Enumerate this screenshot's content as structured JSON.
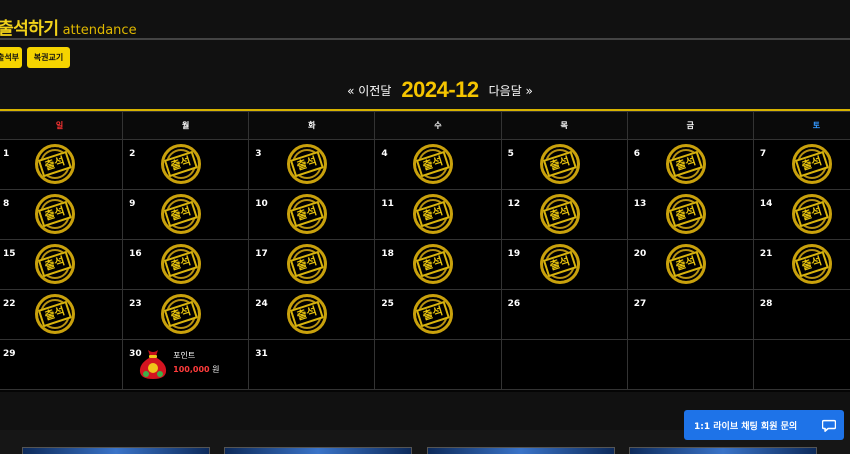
{
  "header": {
    "title": "출석하기",
    "subtitle": "attendance"
  },
  "tabs": [
    {
      "label": "출석부"
    },
    {
      "label": "복권교기"
    }
  ],
  "month_nav": {
    "prev_label": "« 이전달",
    "current_month": "2024-12",
    "next_label": "다음달 »"
  },
  "calendar": {
    "weekday_headers": [
      "일",
      "월",
      "화",
      "수",
      "목",
      "금",
      "토"
    ],
    "stamp_label": "출석",
    "weeks": [
      [
        {
          "day": "1",
          "stamp": true
        },
        {
          "day": "2",
          "stamp": true
        },
        {
          "day": "3",
          "stamp": true
        },
        {
          "day": "4",
          "stamp": true
        },
        {
          "day": "5",
          "stamp": true
        },
        {
          "day": "6",
          "stamp": true
        },
        {
          "day": "7",
          "stamp": true
        }
      ],
      [
        {
          "day": "8",
          "stamp": true
        },
        {
          "day": "9",
          "stamp": true
        },
        {
          "day": "10",
          "stamp": true
        },
        {
          "day": "11",
          "stamp": true
        },
        {
          "day": "12",
          "stamp": true
        },
        {
          "day": "13",
          "stamp": true
        },
        {
          "day": "14",
          "stamp": true
        }
      ],
      [
        {
          "day": "15",
          "stamp": true
        },
        {
          "day": "16",
          "stamp": true
        },
        {
          "day": "17",
          "stamp": true
        },
        {
          "day": "18",
          "stamp": true
        },
        {
          "day": "19",
          "stamp": true
        },
        {
          "day": "20",
          "stamp": true
        },
        {
          "day": "21",
          "stamp": true
        }
      ],
      [
        {
          "day": "22",
          "stamp": true
        },
        {
          "day": "23",
          "stamp": true
        },
        {
          "day": "24",
          "stamp": true
        },
        {
          "day": "25",
          "stamp": true
        },
        {
          "day": "26",
          "stamp": false
        },
        {
          "day": "27",
          "stamp": false
        },
        {
          "day": "28",
          "stamp": false
        }
      ],
      [
        {
          "day": "29",
          "stamp": false
        },
        {
          "day": "30",
          "stamp": false,
          "reward": true
        },
        {
          "day": "31",
          "stamp": false
        },
        {
          "day": "",
          "stamp": false
        },
        {
          "day": "",
          "stamp": false
        },
        {
          "day": "",
          "stamp": false
        },
        {
          "day": "",
          "stamp": false
        }
      ]
    ],
    "reward": {
      "title": "포인트",
      "amount": "100,000",
      "unit": "원",
      "icon": "money-bag-icon"
    }
  },
  "chat_widget": {
    "label": "1:1 라이브 채팅 회원 문의",
    "icon": "chat-bubble-icon"
  },
  "colors": {
    "accent_yellow": "#f5d400",
    "month_gold": "#f5c400",
    "sunday_red": "#ff3333",
    "saturday_blue": "#3399ff",
    "reward_red": "#ff3b3b",
    "chat_blue": "#1e73e8"
  }
}
